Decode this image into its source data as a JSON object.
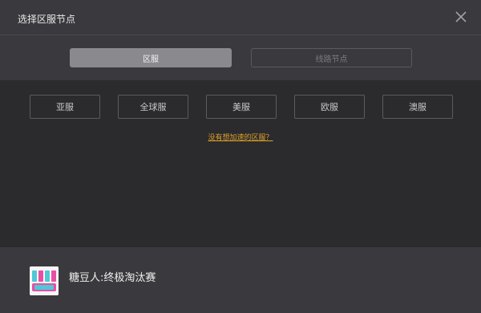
{
  "header": {
    "title": "选择区服节点"
  },
  "tabs": [
    {
      "label": "区服",
      "active": true
    },
    {
      "label": "线路节点",
      "active": false
    }
  ],
  "regions": [
    {
      "label": "亚服"
    },
    {
      "label": "全球服"
    },
    {
      "label": "美服"
    },
    {
      "label": "欧服"
    },
    {
      "label": "澳服"
    }
  ],
  "missing_region_link": "没有想加速的区服？",
  "game": {
    "name": "糖豆人:终极淘汰赛",
    "icon": "fall-guys-logo"
  },
  "colors": {
    "accent_link": "#e0a126",
    "active_tab": "#8a8a8e",
    "panel": "#3a3a3e",
    "background": "#2b2b2e"
  }
}
